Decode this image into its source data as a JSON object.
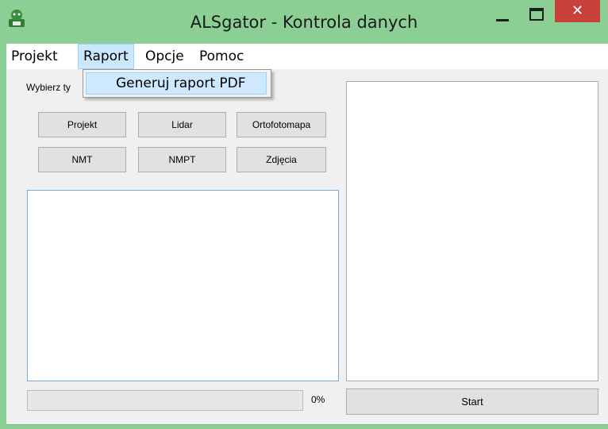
{
  "window": {
    "title": "ALSgator - Kontrola danych",
    "close_glyph": "✕",
    "accent": "#8ccf95",
    "close_color": "#c7403a"
  },
  "menu": {
    "items": [
      {
        "label": "Projekt"
      },
      {
        "label": "Raport"
      },
      {
        "label": "Opcje"
      },
      {
        "label": "Pomoc"
      }
    ],
    "active_index": 1,
    "dropdown": {
      "items": [
        {
          "label": "Generuj raport PDF"
        }
      ]
    }
  },
  "main": {
    "choose_label": "Wybierz ty",
    "buttons": [
      {
        "label": "Projekt"
      },
      {
        "label": "Lidar"
      },
      {
        "label": "Ortofotomapa"
      },
      {
        "label": "NMT"
      },
      {
        "label": "NMPT"
      },
      {
        "label": "Zdjęcia"
      }
    ],
    "progress": {
      "value": 0,
      "text": "0%"
    },
    "start_label": "Start"
  },
  "icons": {
    "app": "alsgator-app-icon",
    "minimize": "minimize-icon",
    "maximize": "maximize-icon",
    "close": "close-icon"
  }
}
